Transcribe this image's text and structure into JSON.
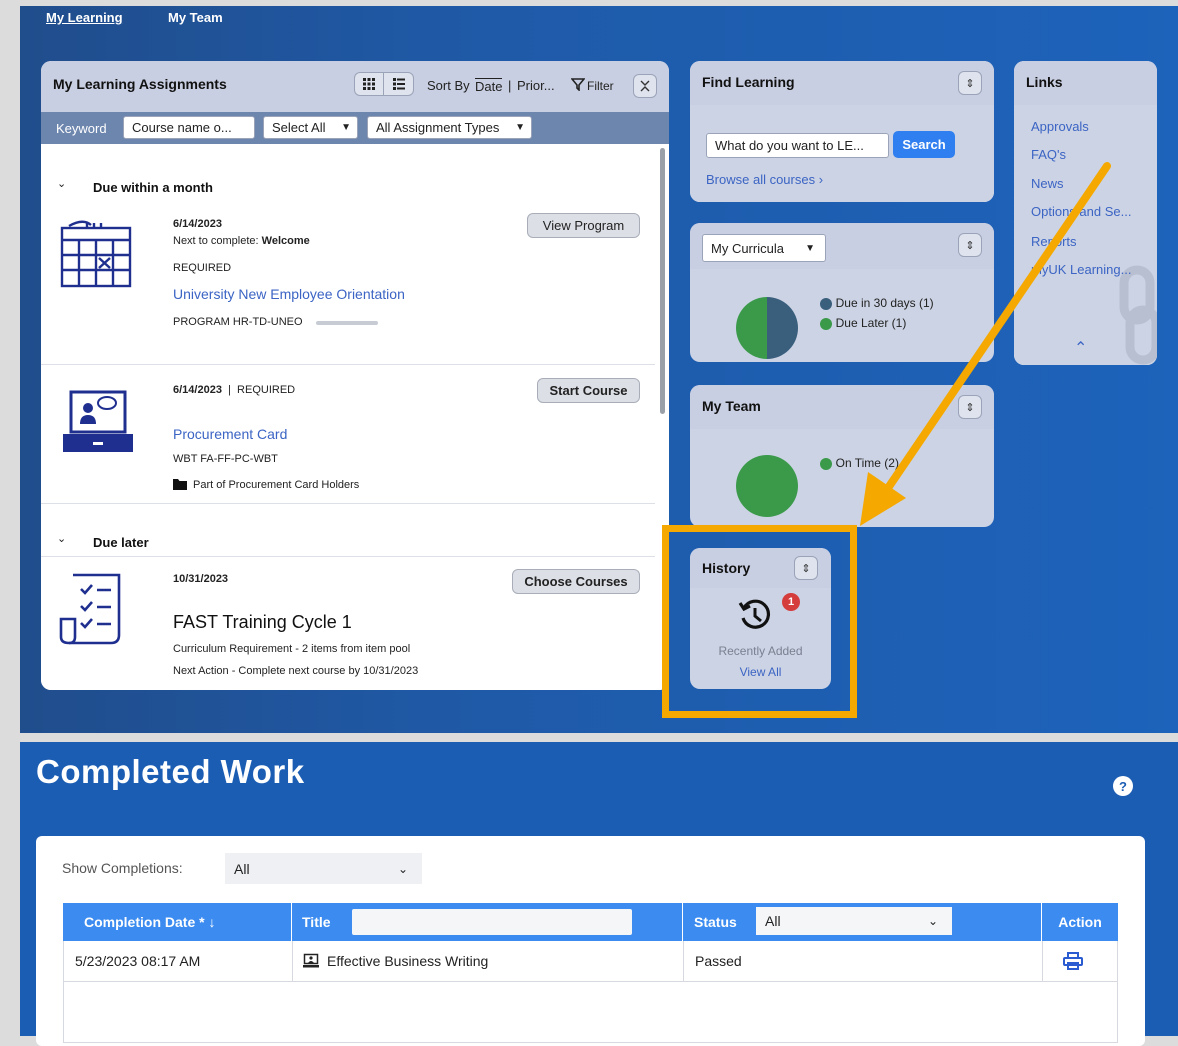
{
  "nav": {
    "my_learning": "My Learning",
    "my_team": "My Team"
  },
  "assignments": {
    "title": "My Learning Assignments",
    "sort_label": "Sort By",
    "sort_date": "Date",
    "sort_priority": "Prior...",
    "filter_label": "Filter",
    "keyword_label": "Keyword",
    "keyword_placeholder": "Course name o...",
    "select_all": "Select All",
    "assignment_types": "All Assignment Types",
    "section_due_month": "Due within a month",
    "section_due_later": "Due later",
    "items": [
      {
        "date": "6/14/2023",
        "next_prefix": "Next to complete: ",
        "next_value": "Welcome",
        "required": "REQUIRED",
        "title": "University New Employee Orientation",
        "code": "PROGRAM HR-TD-UNEO",
        "button": "View Program"
      },
      {
        "date": "6/14/2023",
        "separator": "|",
        "required": "REQUIRED",
        "title": "Procurement Card",
        "code": "WBT FA-FF-PC-WBT",
        "part_of": "Part of Procurement Card Holders",
        "button": "Start Course"
      },
      {
        "date": "10/31/2023",
        "title": "FAST Training Cycle 1",
        "requirement": "Curriculum Requirement - 2 items from item pool",
        "next_action": "Next Action - Complete next course by 10/31/2023",
        "button": "Choose Courses"
      }
    ]
  },
  "find_learning": {
    "title": "Find Learning",
    "search_placeholder": "What do you want to LE...",
    "search_button": "Search",
    "browse": "Browse all courses ›"
  },
  "curricula": {
    "select": "My Curricula",
    "legend": [
      {
        "label": "Due in 30 days (1)",
        "color": "#3a5f7d"
      },
      {
        "label": "Due Later (1)",
        "color": "#3a9a4a"
      }
    ]
  },
  "my_team": {
    "title": "My Team",
    "legend": [
      {
        "label": "On Time (2)",
        "color": "#3a9a4a"
      }
    ]
  },
  "history": {
    "title": "History",
    "badge": "1",
    "recently_added": "Recently Added",
    "view_all": "View All"
  },
  "links": {
    "title": "Links",
    "items": [
      "Approvals",
      "FAQ's",
      "News",
      "Options and Se...",
      "Reports",
      "myUK Learning..."
    ]
  },
  "completed": {
    "title": "Completed Work",
    "help": "?",
    "show_label": "Show Completions:",
    "show_value": "All",
    "columns": {
      "date": "Completion Date *",
      "title": "Title",
      "status": "Status",
      "status_value": "All",
      "action": "Action"
    },
    "rows": [
      {
        "date": "5/23/2023 08:17 AM",
        "title": "Effective Business Writing",
        "status": "Passed"
      }
    ]
  },
  "colors": {
    "highlight": "#f5a800",
    "brand_blue": "#1d5cb6",
    "table_header": "#3b8bf0"
  }
}
